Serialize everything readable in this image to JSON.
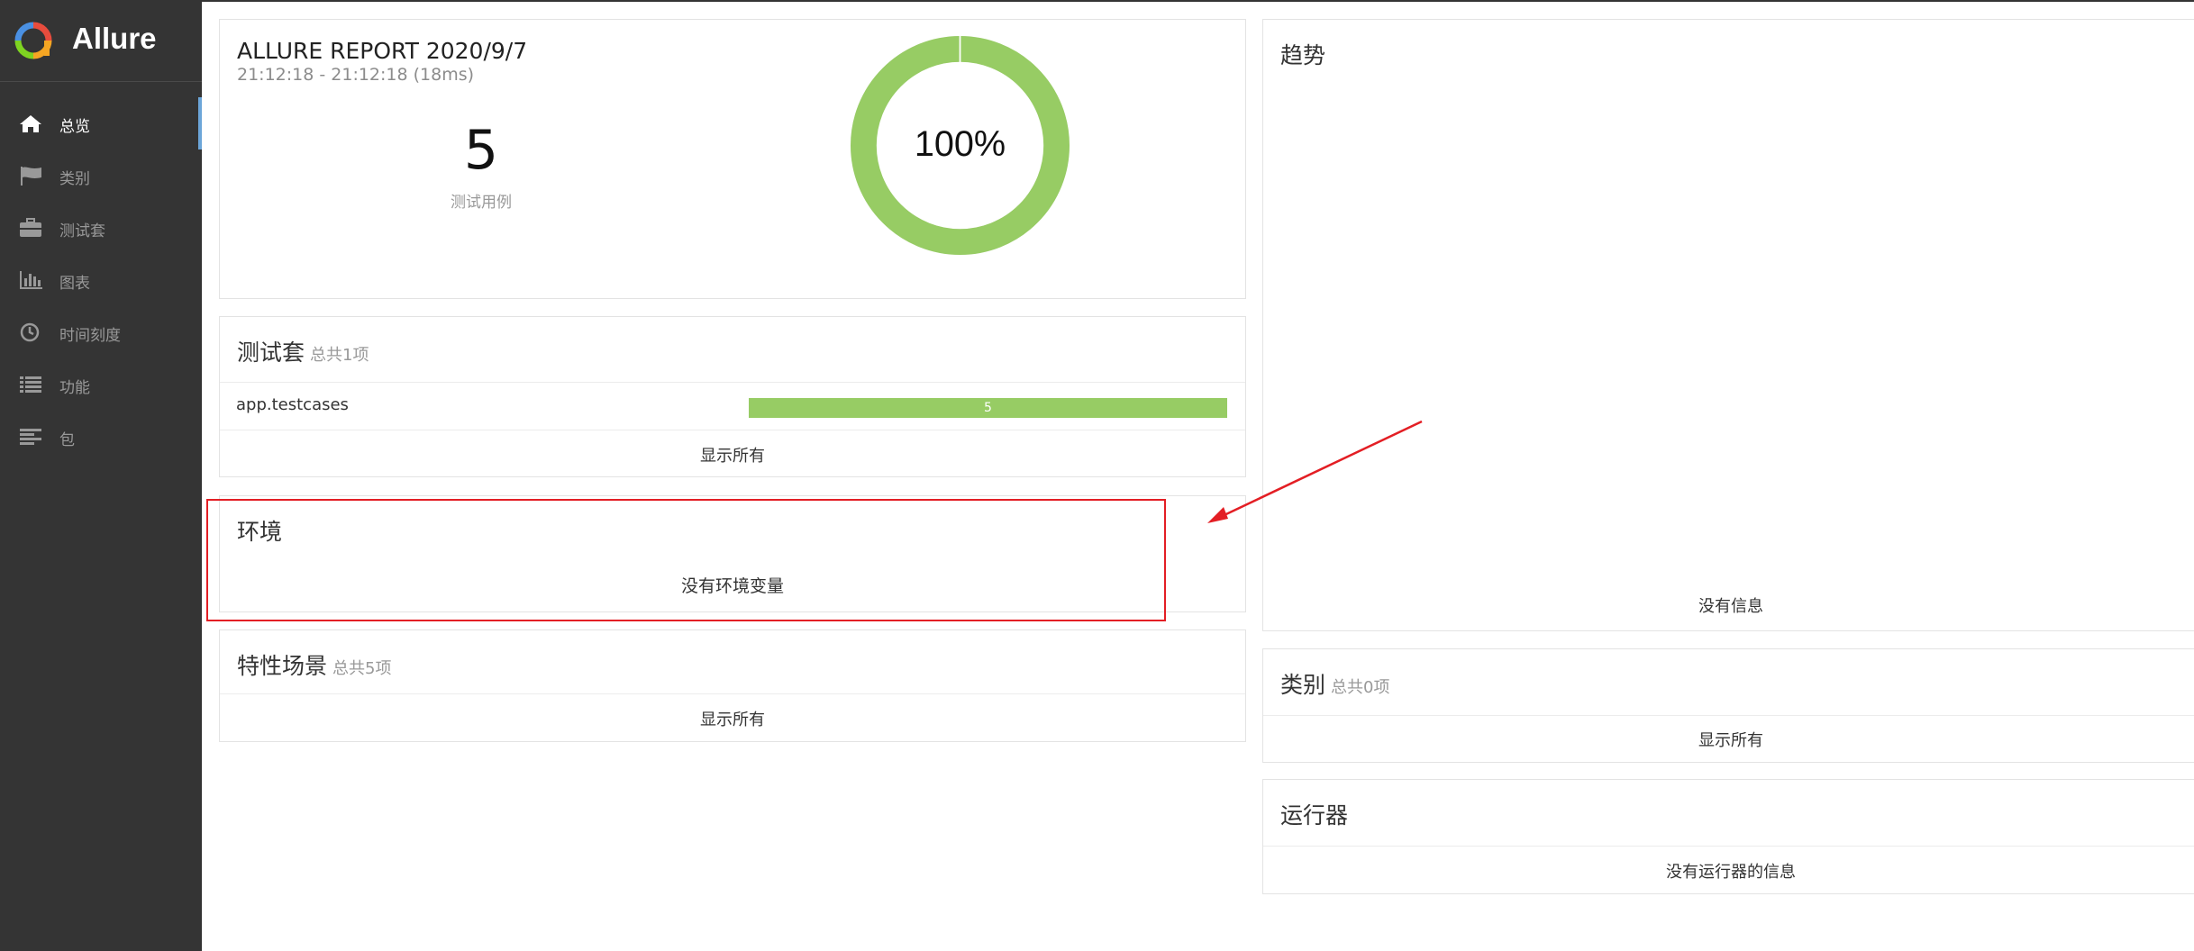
{
  "brand": {
    "name": "Allure",
    "logo_icon": "allure-logo-icon"
  },
  "sidebar": {
    "items": [
      {
        "label": "总览",
        "icon": "home-icon",
        "active": true
      },
      {
        "label": "类别",
        "icon": "flag-icon",
        "active": false
      },
      {
        "label": "测试套",
        "icon": "briefcase-icon",
        "active": false
      },
      {
        "label": "图表",
        "icon": "bar-chart-icon",
        "active": false
      },
      {
        "label": "时间刻度",
        "icon": "clock-icon",
        "active": false
      },
      {
        "label": "功能",
        "icon": "list-icon",
        "active": false
      },
      {
        "label": "包",
        "icon": "align-left-icon",
        "active": false
      }
    ]
  },
  "summary": {
    "title": "ALLURE REPORT 2020/9/7",
    "time_range": "21:12:18 - 21:12:18 (18ms)",
    "test_count": "5",
    "test_count_label": "测试用例",
    "pass_rate_text": "100%",
    "pass_rate_fraction": 1.0,
    "pass_color": "#97cc64"
  },
  "suites": {
    "title": "测试套",
    "subtitle": "总共1项",
    "rows": [
      {
        "name": "app.testcases",
        "count": "5"
      }
    ],
    "show_all": "显示所有"
  },
  "environment": {
    "title": "环境",
    "empty_text": "没有环境变量"
  },
  "features": {
    "title": "特性场景",
    "subtitle": "总共5项",
    "show_all": "显示所有"
  },
  "trend": {
    "title": "趋势",
    "empty_text": "没有信息"
  },
  "categories": {
    "title": "类别",
    "subtitle": "总共0项",
    "show_all": "显示所有"
  },
  "executors": {
    "title": "运行器",
    "empty_text": "没有运行器的信息"
  },
  "annotation": {
    "highlight_color": "#e31e24"
  }
}
